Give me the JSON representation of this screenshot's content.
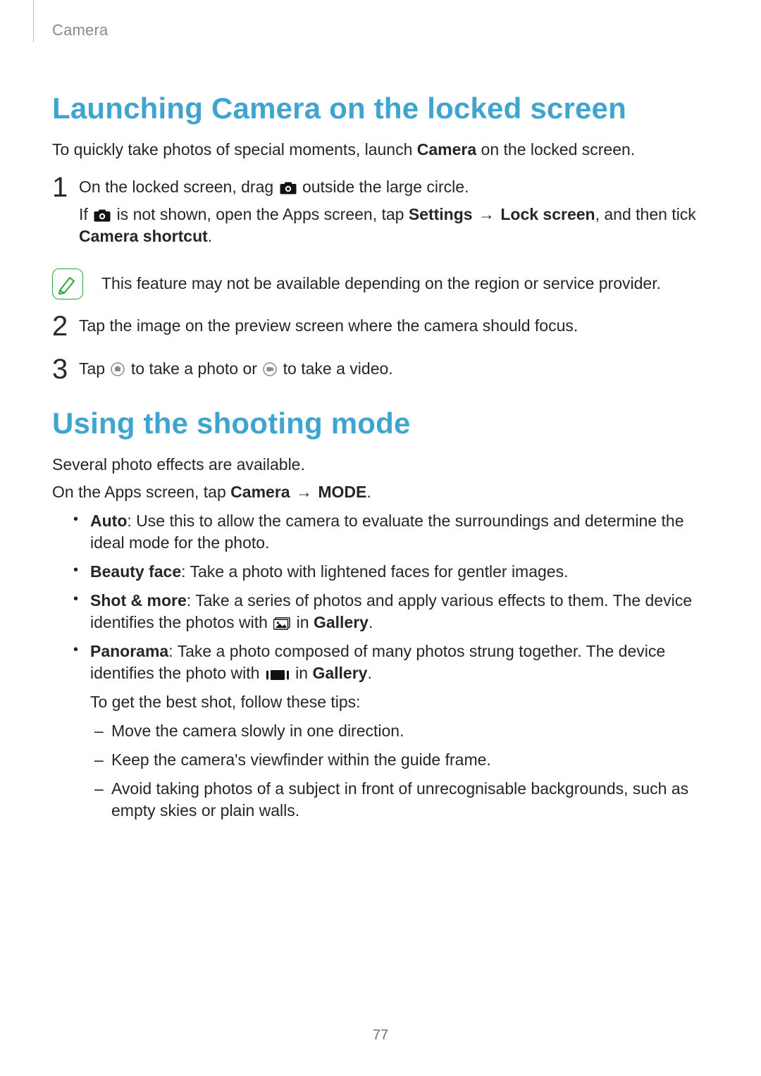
{
  "header": {
    "section": "Camera"
  },
  "page_number": "77",
  "section1": {
    "title": "Launching Camera on the locked screen",
    "intro_pre": "To quickly take photos of special moments, launch ",
    "intro_bold": "Camera",
    "intro_post": " on the locked screen.",
    "step1": {
      "num": "1",
      "line1_pre": "On the locked screen, drag ",
      "line1_post": " outside the large circle.",
      "line2_pre": "If ",
      "line2_mid1": " is not shown, open the Apps screen, tap ",
      "line2_bold1": "Settings",
      "line2_arrow": " → ",
      "line2_bold2": "Lock screen",
      "line2_mid2": ", and then tick ",
      "line2_bold3": "Camera shortcut",
      "line2_end": "."
    },
    "note": "This feature may not be available depending on the region or service provider.",
    "step2": {
      "num": "2",
      "text": "Tap the image on the preview screen where the camera should focus."
    },
    "step3": {
      "num": "3",
      "pre": "Tap ",
      "mid": " to take a photo or ",
      "post": " to take a video."
    }
  },
  "section2": {
    "title": "Using the shooting mode",
    "intro": "Several photo effects are available.",
    "path_pre": "On the Apps screen, tap ",
    "path_b1": "Camera",
    "path_arrow": " → ",
    "path_b2": "MODE",
    "path_end": ".",
    "bullets": {
      "auto": {
        "name": "Auto",
        "text": ": Use this to allow the camera to evaluate the surroundings and determine the ideal mode for the photo."
      },
      "beauty": {
        "name": "Beauty face",
        "text": ": Take a photo with lightened faces for gentler images."
      },
      "shotmore": {
        "name": "Shot & more",
        "text_pre": ": Take a series of photos and apply various effects to them. The device identifies the photos with ",
        "in": " in ",
        "gallery": "Gallery",
        "end": "."
      },
      "panorama": {
        "name": "Panorama",
        "text_pre": ": Take a photo composed of many photos strung together. The device identifies the photo with ",
        "in": " in ",
        "gallery": "Gallery",
        "end": ".",
        "tips_intro": "To get the best shot, follow these tips:",
        "tips": {
          "t1": "Move the camera slowly in one direction.",
          "t2": "Keep the camera's viewfinder within the guide frame.",
          "t3": "Avoid taking photos of a subject in front of unrecognisable backgrounds, such as empty skies or plain walls."
        }
      }
    }
  }
}
